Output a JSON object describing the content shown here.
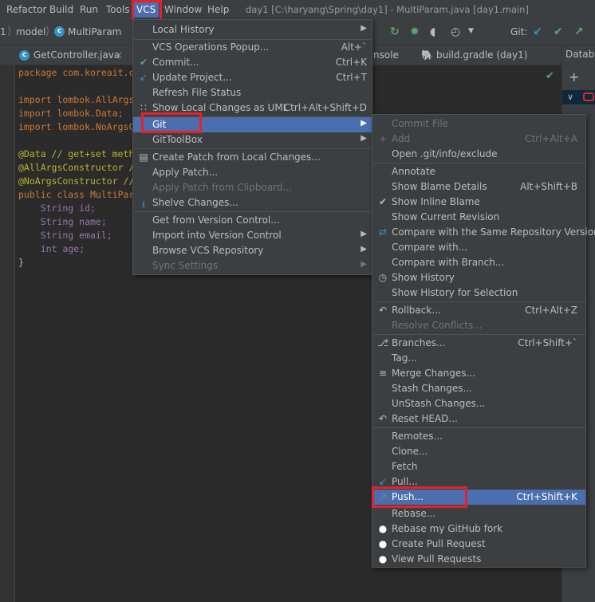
{
  "menubar": {
    "items": [
      "Refactor",
      "Build",
      "Run",
      "Tools",
      "VCS",
      "Window",
      "Help"
    ],
    "window_title": "day1 [C:\\haryang\\Spring\\day1] - MultiParam.java [day1.main]"
  },
  "breadcrumb": {
    "items": [
      "1",
      "model",
      "MultiParam"
    ]
  },
  "toolbar": {
    "git_label": "Git:"
  },
  "tabs": [
    "GetController.java",
    "nsole",
    "build.gradle (day1)"
  ],
  "right_panel": {
    "title": "Databa"
  },
  "editor": {
    "lines": [
      "package com.koreait.c",
      "",
      "import lombok.AllArgs",
      "import lombok.Data;",
      "import lombok.NoArgsC",
      "",
      "@Data // get+set meth",
      "@AllArgsConstructor /",
      "@NoArgsConstructor //",
      "public class MultiPar",
      "    String id;",
      "    String name;",
      "    String email;",
      "    int age;",
      "}"
    ]
  },
  "vcs_menu": {
    "items": [
      {
        "label": "Local History",
        "shortcut": "",
        "submenu": true
      },
      {
        "label": "VCS Operations Popup...",
        "shortcut": "Alt+`"
      },
      {
        "label": "Commit...",
        "shortcut": "Ctrl+K",
        "icon": "check-icon"
      },
      {
        "label": "Update Project...",
        "shortcut": "Ctrl+T",
        "icon": "update-arrow-icon"
      },
      {
        "label": "Refresh File Status",
        "shortcut": ""
      },
      {
        "label": "Show Local Changes as UML",
        "shortcut": "Ctrl+Alt+Shift+D",
        "icon": "uml-icon"
      },
      {
        "label": "Git",
        "shortcut": "",
        "submenu": true
      },
      {
        "label": "GitToolBox",
        "shortcut": "",
        "submenu": true
      },
      {
        "label": "Create Patch from Local Changes...",
        "shortcut": "",
        "icon": "patch-icon"
      },
      {
        "label": "Apply Patch...",
        "shortcut": ""
      },
      {
        "label": "Apply Patch from Clipboard...",
        "shortcut": ""
      },
      {
        "label": "Shelve Changes...",
        "shortcut": "",
        "icon": "shelve-icon"
      },
      {
        "label": "Get from Version Control...",
        "shortcut": ""
      },
      {
        "label": "Import into Version Control",
        "shortcut": "",
        "submenu": true
      },
      {
        "label": "Browse VCS Repository",
        "shortcut": "",
        "submenu": true
      },
      {
        "label": "Sync Settings",
        "shortcut": "",
        "submenu": true
      }
    ]
  },
  "git_menu": {
    "items": [
      {
        "label": "Commit File",
        "shortcut": ""
      },
      {
        "label": "Add",
        "shortcut": "Ctrl+Alt+A"
      },
      {
        "label": "Open .git/info/exclude",
        "shortcut": ""
      },
      {
        "label": "Annotate",
        "shortcut": ""
      },
      {
        "label": "Show Blame Details",
        "shortcut": "Alt+Shift+B"
      },
      {
        "label": "Show Inline Blame",
        "shortcut": ""
      },
      {
        "label": "Show Current Revision",
        "shortcut": ""
      },
      {
        "label": "Compare with the Same Repository Version",
        "shortcut": ""
      },
      {
        "label": "Compare with...",
        "shortcut": ""
      },
      {
        "label": "Compare with Branch...",
        "shortcut": ""
      },
      {
        "label": "Show History",
        "shortcut": ""
      },
      {
        "label": "Show History for Selection",
        "shortcut": ""
      },
      {
        "label": "Rollback...",
        "shortcut": "Ctrl+Alt+Z"
      },
      {
        "label": "Resolve Conflicts...",
        "shortcut": ""
      },
      {
        "label": "Branches...",
        "shortcut": "Ctrl+Shift+`"
      },
      {
        "label": "Tag...",
        "shortcut": ""
      },
      {
        "label": "Merge Changes...",
        "shortcut": ""
      },
      {
        "label": "Stash Changes...",
        "shortcut": ""
      },
      {
        "label": "UnStash Changes...",
        "shortcut": ""
      },
      {
        "label": "Reset HEAD...",
        "shortcut": ""
      },
      {
        "label": "Remotes...",
        "shortcut": ""
      },
      {
        "label": "Clone...",
        "shortcut": ""
      },
      {
        "label": "Fetch",
        "shortcut": ""
      },
      {
        "label": "Pull...",
        "shortcut": ""
      },
      {
        "label": "Push...",
        "shortcut": "Ctrl+Shift+K"
      },
      {
        "label": "Rebase...",
        "shortcut": ""
      },
      {
        "label": "Rebase my GitHub fork",
        "shortcut": ""
      },
      {
        "label": "Create Pull Request",
        "shortcut": ""
      },
      {
        "label": "View Pull Requests",
        "shortcut": ""
      }
    ]
  },
  "colors": {
    "selection": "#4b6eaf",
    "highlight_box": "#e8202a",
    "menu_bg": "#3c3f41",
    "editor_bg": "#2b2b2b"
  }
}
